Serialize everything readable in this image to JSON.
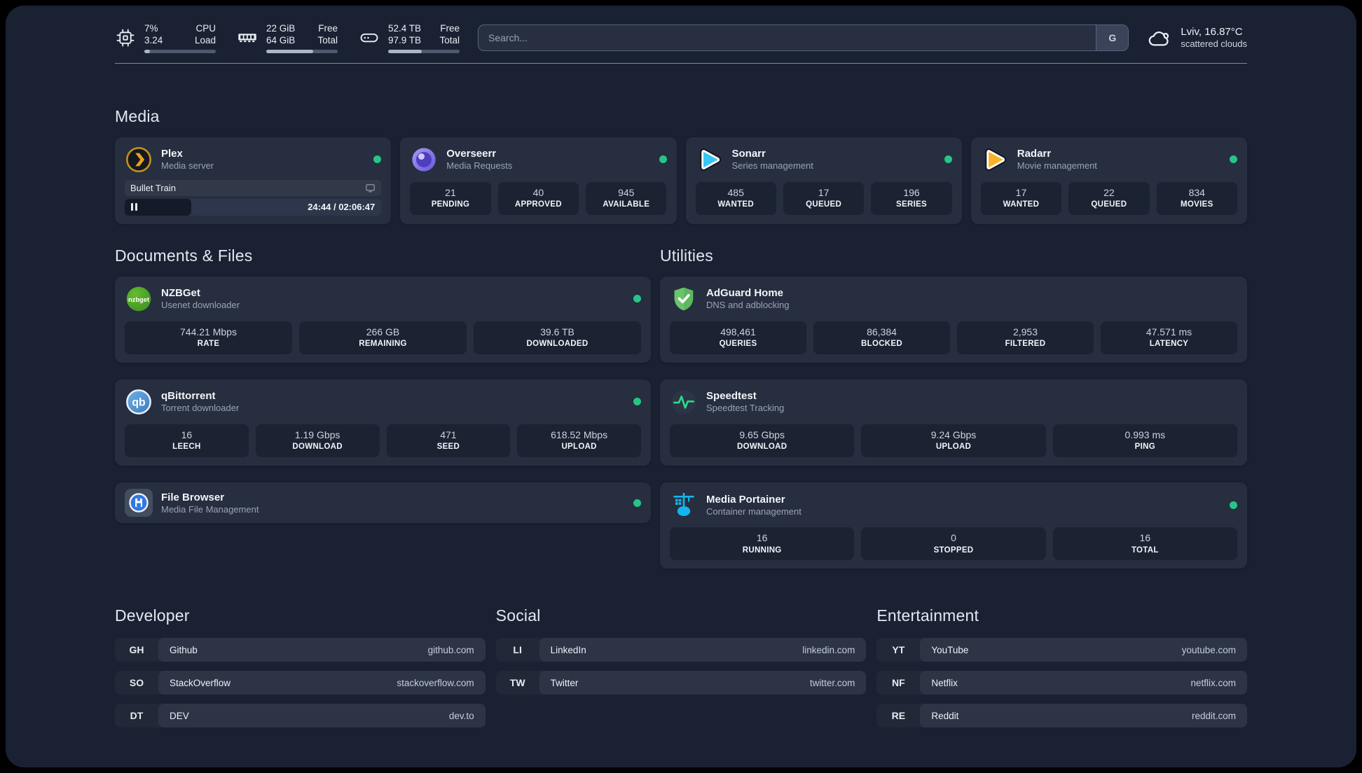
{
  "topbar": {
    "cpu": {
      "usage": "7%",
      "load": "3.24",
      "label_top": "CPU",
      "label_bottom": "Load",
      "progress_pct": 8
    },
    "memory": {
      "free": "22 GiB",
      "total": "64 GiB",
      "label_top": "Free",
      "label_bottom": "Total",
      "progress_pct": 66
    },
    "disk": {
      "free": "52.4 TB",
      "total": "97.9 TB",
      "label_top": "Free",
      "label_bottom": "Total",
      "progress_pct": 47
    },
    "search": {
      "placeholder": "Search...",
      "provider_button": "G"
    },
    "weather": {
      "location_temp": "Lviv, 16.87°C",
      "condition": "scattered clouds"
    }
  },
  "sections": {
    "media": {
      "title": "Media",
      "plex": {
        "name": "Plex",
        "subtitle": "Media server",
        "online": true,
        "now_playing": {
          "title": "Bullet Train",
          "state": "paused",
          "elapsed": "24:44",
          "duration": "02:06:47",
          "time_display": "24:44 / 02:06:47",
          "progress_pct": 26
        }
      },
      "overseerr": {
        "name": "Overseerr",
        "subtitle": "Media Requests",
        "online": true,
        "stats": [
          {
            "value": "21",
            "label": "PENDING"
          },
          {
            "value": "40",
            "label": "APPROVED"
          },
          {
            "value": "945",
            "label": "AVAILABLE"
          }
        ]
      },
      "sonarr": {
        "name": "Sonarr",
        "subtitle": "Series management",
        "online": true,
        "stats": [
          {
            "value": "485",
            "label": "WANTED"
          },
          {
            "value": "17",
            "label": "QUEUED"
          },
          {
            "value": "196",
            "label": "SERIES"
          }
        ]
      },
      "radarr": {
        "name": "Radarr",
        "subtitle": "Movie management",
        "online": true,
        "stats": [
          {
            "value": "17",
            "label": "WANTED"
          },
          {
            "value": "22",
            "label": "QUEUED"
          },
          {
            "value": "834",
            "label": "MOVIES"
          }
        ]
      }
    },
    "documents": {
      "title": "Documents & Files",
      "nzbget": {
        "name": "NZBGet",
        "subtitle": "Usenet downloader",
        "online": true,
        "stats": [
          {
            "value": "744.21 Mbps",
            "label": "RATE"
          },
          {
            "value": "266 GB",
            "label": "REMAINING"
          },
          {
            "value": "39.6 TB",
            "label": "DOWNLOADED"
          }
        ]
      },
      "qbittorrent": {
        "name": "qBittorrent",
        "subtitle": "Torrent downloader",
        "online": true,
        "stats": [
          {
            "value": "16",
            "label": "LEECH"
          },
          {
            "value": "1.19 Gbps",
            "label": "DOWNLOAD"
          },
          {
            "value": "471",
            "label": "SEED"
          },
          {
            "value": "618.52 Mbps",
            "label": "UPLOAD"
          }
        ]
      },
      "filebrowser": {
        "name": "File Browser",
        "subtitle": "Media File Management",
        "online": true
      }
    },
    "utilities": {
      "title": "Utilities",
      "adguard": {
        "name": "AdGuard Home",
        "subtitle": "DNS and adblocking",
        "stats": [
          {
            "value": "498,461",
            "label": "QUERIES"
          },
          {
            "value": "86,384",
            "label": "BLOCKED"
          },
          {
            "value": "2,953",
            "label": "FILTERED"
          },
          {
            "value": "47.571 ms",
            "label": "LATENCY"
          }
        ]
      },
      "speedtest": {
        "name": "Speedtest",
        "subtitle": "Speedtest Tracking",
        "stats": [
          {
            "value": "9.65 Gbps",
            "label": "DOWNLOAD"
          },
          {
            "value": "9.24 Gbps",
            "label": "UPLOAD"
          },
          {
            "value": "0.993 ms",
            "label": "PING"
          }
        ]
      },
      "portainer": {
        "name": "Media Portainer",
        "subtitle": "Container management",
        "online": true,
        "stats": [
          {
            "value": "16",
            "label": "RUNNING"
          },
          {
            "value": "0",
            "label": "STOPPED"
          },
          {
            "value": "16",
            "label": "TOTAL"
          }
        ]
      }
    },
    "developer": {
      "title": "Developer",
      "links": [
        {
          "badge": "GH",
          "name": "Github",
          "url": "github.com"
        },
        {
          "badge": "SO",
          "name": "StackOverflow",
          "url": "stackoverflow.com"
        },
        {
          "badge": "DT",
          "name": "DEV",
          "url": "dev.to"
        }
      ]
    },
    "social": {
      "title": "Social",
      "links": [
        {
          "badge": "LI",
          "name": "LinkedIn",
          "url": "linkedin.com"
        },
        {
          "badge": "TW",
          "name": "Twitter",
          "url": "twitter.com"
        }
      ]
    },
    "entertainment": {
      "title": "Entertainment",
      "links": [
        {
          "badge": "YT",
          "name": "YouTube",
          "url": "youtube.com"
        },
        {
          "badge": "NF",
          "name": "Netflix",
          "url": "netflix.com"
        },
        {
          "badge": "RE",
          "name": "Reddit",
          "url": "reddit.com"
        }
      ]
    }
  },
  "icon_labels": {
    "nzbget": "nzbget",
    "qbittorrent": "qb"
  },
  "colors": {
    "status_online": "#25c685",
    "plex_gold": "#e8a020",
    "sonarr_blue": "#38c6f4",
    "radarr_gold": "#f8b227",
    "portainer_blue": "#13b5ea",
    "speedtest_green": "#2bd98c",
    "adguard_green": "#5cb85c",
    "overseerr_purple": "#6a58d8",
    "qbittorrent_blue": "#4c8fd0",
    "nzbget_green": "#4aa32a",
    "filebrowser_blue": "#3178e6"
  }
}
